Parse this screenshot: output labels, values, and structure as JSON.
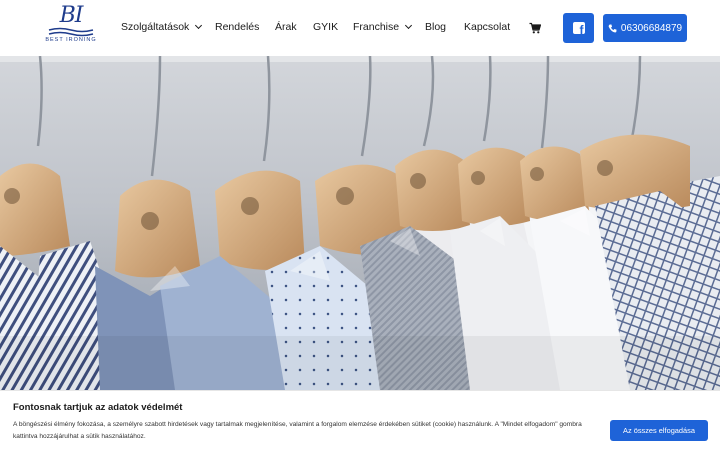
{
  "brand": {
    "logo_mark": "BI",
    "logo_text": "BEST IRONING",
    "color": "#1f3c8c"
  },
  "nav": {
    "items": [
      {
        "label": "Szolgáltatások",
        "dropdown": true
      },
      {
        "label": "Rendelés",
        "dropdown": false
      },
      {
        "label": "Árak",
        "dropdown": false
      },
      {
        "label": "GYIK",
        "dropdown": false
      },
      {
        "label": "Franchise",
        "dropdown": true
      },
      {
        "label": "Blog",
        "dropdown": false
      },
      {
        "label": "Kapcsolat",
        "dropdown": false
      }
    ],
    "cart_icon": "shopping-cart-icon",
    "facebook_icon": "facebook-icon",
    "phone_icon": "phone-icon",
    "phone_number": "06306684879",
    "accent": "#1e63d8"
  },
  "hero": {
    "image": "shirts-on-wooden-hangers"
  },
  "cookie": {
    "title": "Fontosnak tartjuk az adatok védelmét",
    "text": "A böngészési élmény fokozása, a személyre szabott hirdetések vagy tartalmak megjelenítése, valamint a forgalom elemzése érdekében sütiket (cookie) használunk. A \"Mindet elfogadom\" gombra kattintva hozzájárulhat a sütik használatához.",
    "accept_label": "Az összes elfogadása"
  }
}
